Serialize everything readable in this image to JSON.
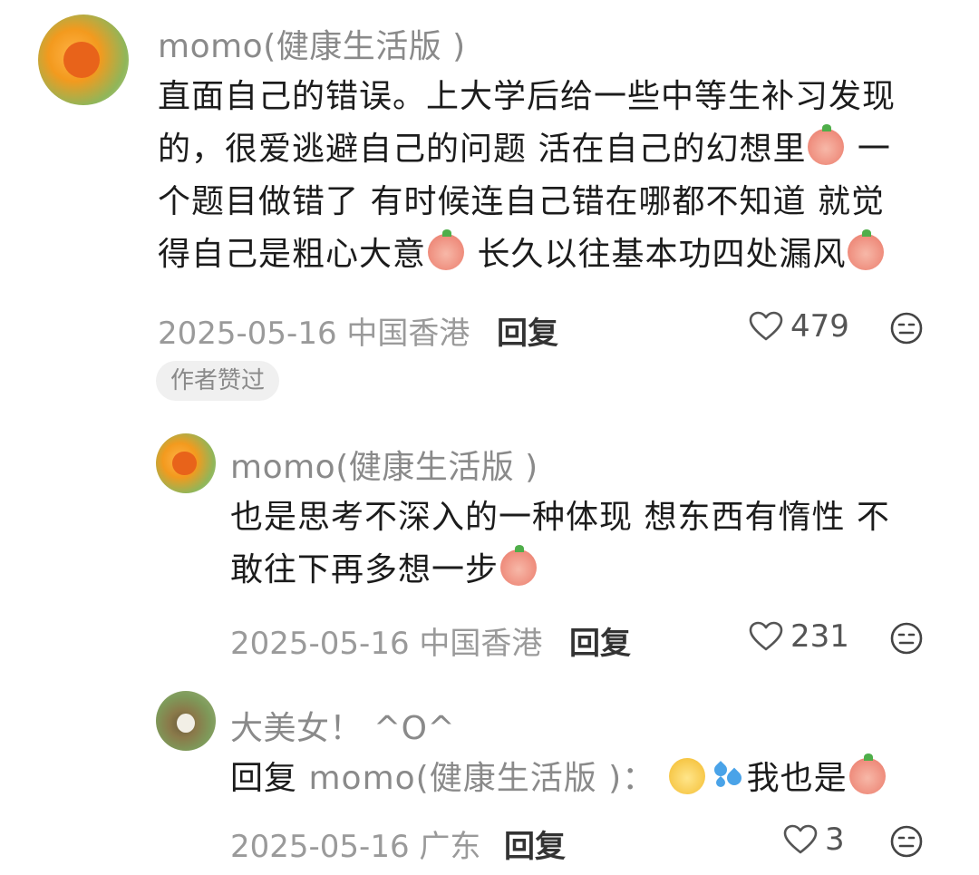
{
  "comments": [
    {
      "author": "momo(健康生活版 )",
      "lines": [
        "直面自己的错误。上大学后给一些中等生补习发现",
        "的，很爱逃避自己的问题 活在自己的幻想里",
        "个题目做错了 有时候连自己错在哪都不知道 就觉",
        "得自己是粗心大意",
        "长久以往基本功四处漏风"
      ],
      "line2_tail": "一",
      "date_location": "2025-05-16 中国香港",
      "reply_label": "回复",
      "likes": "479",
      "badge": "作者赞过"
    },
    {
      "author": "momo(健康生活版 )",
      "lines": [
        "也是思考不深入的一种体现 想东西有惰性 不",
        "敢往下再多想一步"
      ],
      "date_location": "2025-05-16 中国香港",
      "reply_label": "回复",
      "likes": "231"
    },
    {
      "author": "大美女！ ^O^",
      "reply_prefix": "回复",
      "reply_target": "momo(健康生活版 )：",
      "text_tail": "我也是",
      "date_location": "2025-05-16 广东",
      "reply_label": "回复",
      "likes": "3"
    }
  ],
  "icons": {
    "like": "heart-outline-icon",
    "dislike": "neutral-face-icon",
    "emoji_cry": "crying-peach-emoji",
    "emoji_sweat": "sweat-drops-emoji",
    "emoji_yellow": "yellow-face-emoji"
  },
  "colors": {
    "text": "#1c1c1c",
    "muted": "#8a8a8a",
    "badge_bg": "#f0f0f0"
  }
}
